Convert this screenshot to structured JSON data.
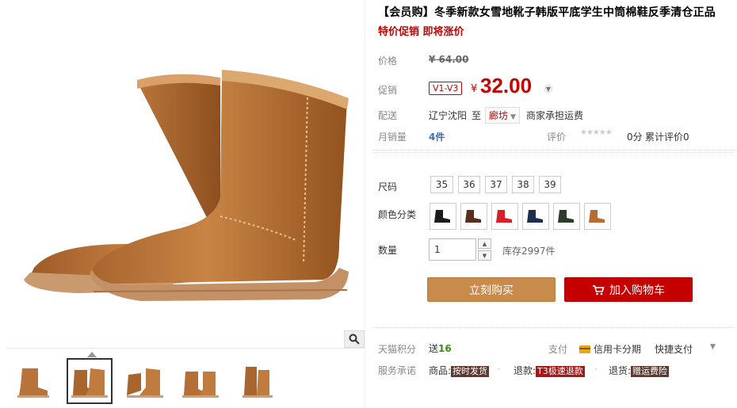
{
  "gallery": {
    "zoom_icon": "magnifier-icon",
    "thumbnails": [
      "boot-pair-side",
      "boot-pair-front",
      "boot-pair-angle",
      "boot-pair-back",
      "boot-pair-detail"
    ],
    "active_thumb_index": 1
  },
  "product": {
    "title": "【会员购】冬季新款女雪地靴子韩版平底学生中筒棉鞋反季清仓正品",
    "promo": "特价促销 即将涨价"
  },
  "price": {
    "label": "价格",
    "original": "¥ 64.00",
    "promo_label": "促销",
    "vip_tag": "V1-V3",
    "currency": "¥",
    "current": "32.00"
  },
  "shipping": {
    "label": "配送",
    "from": "辽宁沈阳",
    "to_word": "至",
    "to_city": "廊坊",
    "fee_note": "商家承担运费"
  },
  "sales": {
    "label": "月销量",
    "count": "4件",
    "rating_label": "评价",
    "stars": "★★★★★",
    "score": "0分",
    "review_link": "累计评价0"
  },
  "options": {
    "size_label": "尺码",
    "sizes": [
      "35",
      "36",
      "37",
      "38",
      "39"
    ],
    "color_label": "颜色分类",
    "colors": [
      {
        "name": "black",
        "hex": "#1b1b1b"
      },
      {
        "name": "brown",
        "hex": "#5a2e1c"
      },
      {
        "name": "red",
        "hex": "#d91e2a"
      },
      {
        "name": "navy",
        "hex": "#1d2d4f"
      },
      {
        "name": "dark-green",
        "hex": "#2d3b2a"
      },
      {
        "name": "chestnut",
        "hex": "#b96b34"
      }
    ]
  },
  "quantity": {
    "label": "数量",
    "value": "1",
    "stock": "库存2997件"
  },
  "actions": {
    "buy_now": "立刻购买",
    "add_cart": "加入购物车"
  },
  "points": {
    "label": "天猫积分",
    "prefix": "送",
    "amount": "16",
    "pay_label": "支付",
    "credit_card": "信用卡分期",
    "quick_pay": "快捷支付"
  },
  "service": {
    "label": "服务承诺",
    "goods_label": "商品:",
    "goods_tag": "按时发货",
    "refund_label": "退款:",
    "refund_tag": "T3极速退款",
    "return_label": "退货:",
    "return_tag": "赠运费险"
  },
  "colors": {
    "accent": "#c40000",
    "buy_button": "#c98b4c",
    "boot": "#b8733a"
  }
}
